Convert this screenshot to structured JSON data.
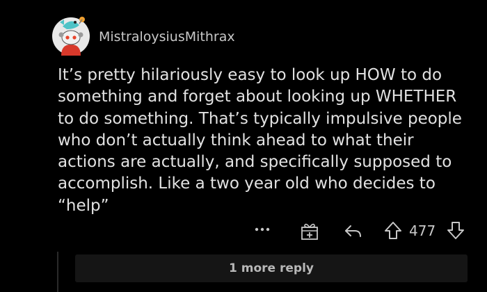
{
  "comment": {
    "username": "MistraloysiusMithrax",
    "avatar_icon": "snoo-avatar-icon",
    "body_lines": [
      "It’s pretty hilariously easy to look up HOW to do",
      "something and forget about looking up WHETHER",
      "to do something. That’s typically impulsive people",
      "who don’t actually think ahead to what their",
      "actions are actually, and specifically supposed to",
      "accomplish. Like a two year old who decides to",
      "“help”"
    ]
  },
  "actions": {
    "more_icon": "more-options-icon",
    "award_icon": "award-icon",
    "reply_icon": "reply-icon",
    "upvote_icon": "upvote-icon",
    "score": "477",
    "downvote_icon": "downvote-icon"
  },
  "replies": {
    "more_label": "1 more reply"
  },
  "colors": {
    "background": "#000000",
    "text": "#e2e2e2",
    "muted": "#c8c8c8",
    "reply_bar": "#151515"
  }
}
